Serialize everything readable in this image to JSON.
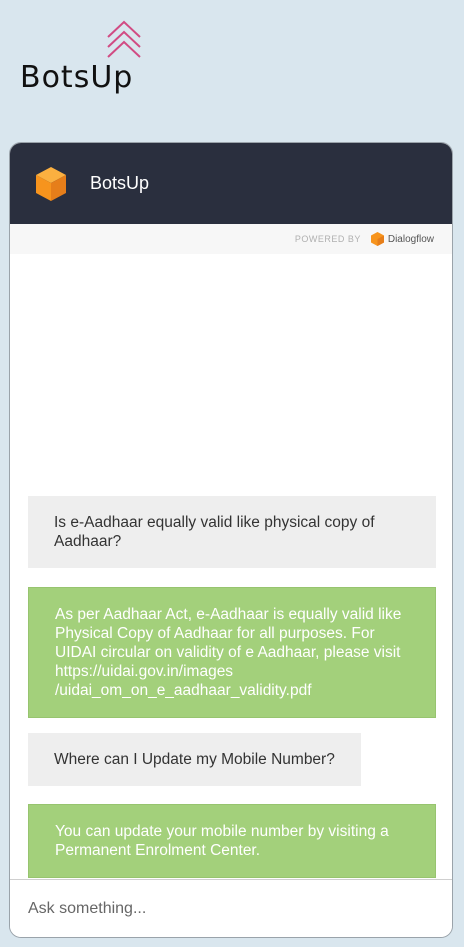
{
  "logo": {
    "text": "BotsUp",
    "icon": "double-chevron-up-icon",
    "accent": "#d14b83"
  },
  "chat": {
    "title": "BotsUp",
    "avatar_icon": "orange-cube-icon",
    "powered_by": "POWERED BY",
    "provider": "Dialogflow",
    "input_placeholder": "Ask something...",
    "messages": [
      {
        "role": "user",
        "text": "Is e-Aadhaar equally valid like physical copy of Aadhaar?"
      },
      {
        "role": "bot",
        "text": "As per Aadhaar Act, e-Aadhaar is equally valid like Physical Copy of Aadhaar for all purposes. For UIDAI circular on validity of e Aadhaar, please visit https://uidai.gov.in/images /uidai_om_on_e_aadhaar_validity.pdf"
      },
      {
        "role": "user",
        "text": "Where can I Update my Mobile Number?"
      },
      {
        "role": "bot",
        "text": "You can update your mobile number by visiting a Permanent Enrolment Center."
      }
    ]
  },
  "colors": {
    "page_bg": "#d9e6ee",
    "header_bg": "#2a2f3e",
    "user_bubble": "#eeeeee",
    "bot_bubble": "#a3d07b",
    "brand_orange": "#f7941d"
  }
}
